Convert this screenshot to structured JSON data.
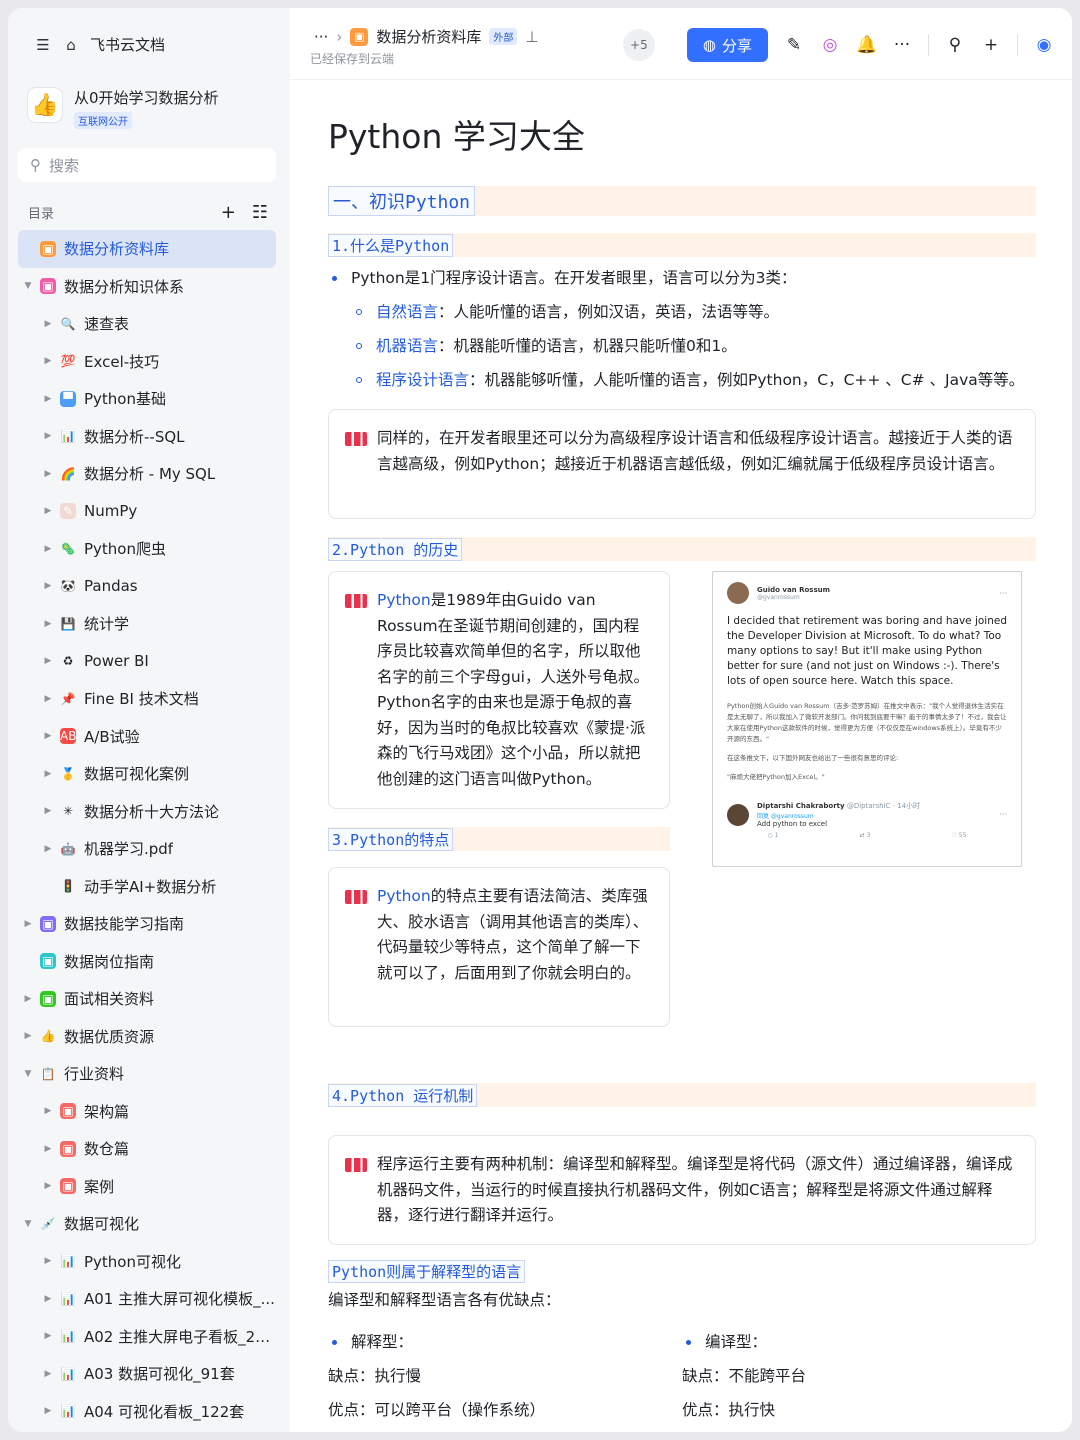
{
  "sidebar": {
    "home_label": "飞书云文档",
    "workspace_title": "从0开始学习数据分析",
    "workspace_tag": "互联网公开",
    "search_placeholder": "搜索",
    "toc_label": "目录",
    "items": [
      {
        "label": "数据分析资料库",
        "level": 0,
        "arrow": "",
        "icon": "▣",
        "color": "#ff9b3d",
        "selected": true
      },
      {
        "label": "数据分析知识体系",
        "level": 0,
        "arrow": "▼",
        "icon": "▣",
        "color": "#f05ca6"
      },
      {
        "label": "速查表",
        "level": 1,
        "arrow": "▶",
        "icon": "🔍",
        "color": "transparent"
      },
      {
        "label": "Excel-技巧",
        "level": 1,
        "arrow": "▶",
        "icon": "💯",
        "color": "transparent"
      },
      {
        "label": "Python基础",
        "level": 1,
        "arrow": "▶",
        "icon": "▀",
        "color": "#4b9ef7"
      },
      {
        "label": "数据分析--SQL",
        "level": 1,
        "arrow": "▶",
        "icon": "📊",
        "color": "transparent"
      },
      {
        "label": "数据分析 - My SQL",
        "level": 1,
        "arrow": "▶",
        "icon": "🌈",
        "color": "transparent"
      },
      {
        "label": "NumPy",
        "level": 1,
        "arrow": "▶",
        "icon": "✎",
        "color": "#f3d9d4"
      },
      {
        "label": "Python爬虫",
        "level": 1,
        "arrow": "▶",
        "icon": "🦠",
        "color": "transparent"
      },
      {
        "label": "Pandas",
        "level": 1,
        "arrow": "▶",
        "icon": "🐼",
        "color": "transparent"
      },
      {
        "label": "统计学",
        "level": 1,
        "arrow": "▶",
        "icon": "💾",
        "color": "transparent"
      },
      {
        "label": "Power BI",
        "level": 1,
        "arrow": "▶",
        "icon": "♻",
        "color": "transparent"
      },
      {
        "label": "Fine BI 技术文档",
        "level": 1,
        "arrow": "▶",
        "icon": "📌",
        "color": "transparent"
      },
      {
        "label": "A/B试验",
        "level": 1,
        "arrow": "▶",
        "icon": "AB",
        "color": "#f54a45"
      },
      {
        "label": "数据可视化案例",
        "level": 1,
        "arrow": "▶",
        "icon": "🥇",
        "color": "transparent"
      },
      {
        "label": "数据分析十大方法论",
        "level": 1,
        "arrow": "▶",
        "icon": "✳",
        "color": "transparent"
      },
      {
        "label": "机器学习.pdf",
        "level": 1,
        "arrow": "▶",
        "icon": "🤖",
        "color": "transparent"
      },
      {
        "label": "动手学AI+数据分析",
        "level": 1,
        "arrow": "",
        "icon": "🚦",
        "color": "transparent"
      },
      {
        "label": "数据技能学习指南",
        "level": 0,
        "arrow": "▶",
        "icon": "▣",
        "color": "#7f6cf7"
      },
      {
        "label": "数据岗位指南",
        "level": 0,
        "arrow": "",
        "icon": "▣",
        "color": "#2ec7c9"
      },
      {
        "label": "面试相关资料",
        "level": 0,
        "arrow": "▶",
        "icon": "▣",
        "color": "#34c724"
      },
      {
        "label": "数据优质资源",
        "level": 0,
        "arrow": "▶",
        "icon": "👍",
        "color": "transparent"
      },
      {
        "label": "行业资料",
        "level": 0,
        "arrow": "▼",
        "icon": "📋",
        "color": "transparent"
      },
      {
        "label": "架构篇",
        "level": 1,
        "arrow": "▶",
        "icon": "▣",
        "color": "#f76964"
      },
      {
        "label": "数仓篇",
        "level": 1,
        "arrow": "▶",
        "icon": "▣",
        "color": "#f76964"
      },
      {
        "label": "案例",
        "level": 1,
        "arrow": "▶",
        "icon": "▣",
        "color": "#f76964"
      },
      {
        "label": "数据可视化",
        "level": 0,
        "arrow": "▼",
        "icon": "💉",
        "color": "transparent"
      },
      {
        "label": "Python可视化",
        "level": 1,
        "arrow": "▶",
        "icon": "📊",
        "color": "transparent"
      },
      {
        "label": "A01 主推大屏可视化模板_...",
        "level": 1,
        "arrow": "▶",
        "icon": "📊",
        "color": "transparent"
      },
      {
        "label": "A02 主推大屏电子看板_20套",
        "level": 1,
        "arrow": "▶",
        "icon": "📊",
        "color": "transparent"
      },
      {
        "label": "A03 数据可视化_91套",
        "level": 1,
        "arrow": "▶",
        "icon": "📊",
        "color": "transparent"
      },
      {
        "label": "A04 可视化看板_122套",
        "level": 1,
        "arrow": "▶",
        "icon": "📊",
        "color": "transparent"
      }
    ]
  },
  "topbar": {
    "more": "···",
    "doc_name": "数据分析资料库",
    "doc_tag": "外部",
    "saved": "已经保存到云端",
    "collaborators": "+5",
    "share_label": "分享"
  },
  "doc": {
    "title": "Python 学习大全",
    "section1": "一、初识Python",
    "s1_h3": "1.什么是Python",
    "s1_bullet": "Python是1门程序设计语言。在开发者眼里，语言可以分为3类：",
    "s1_subs": [
      {
        "term": "自然语言",
        "text": "：人能听懂的语言，例如汉语，英语，法语等等。"
      },
      {
        "term": "机器语言",
        "text": "：机器能听懂的语言，机器只能听懂0和1。"
      },
      {
        "term": "程序设计语言",
        "text": "：机器能够听懂，人能听懂的语言，例如Python，C，C++ 、C# 、Java等等。"
      }
    ],
    "s1_callout": "同样的，在开发者眼里还可以分为高级程序设计语言和低级程序设计语言。越接近于人类的语言越高级，例如Python；越接近于机器语言越低级，例如汇编就属于低级程序员设计语言。",
    "s2_h3": "2.Python 的历史",
    "s2_term": "Python",
    "s2_callout": "是1989年由Guido van Rossum在圣诞节期间创建的，国内程序员比较喜欢简单但的名字，所以取他名字的前三个字母gui，人送外号龟叔。Python名字的由来也是源于龟叔的喜好，因为当时的龟叔比较喜欢《蒙提·派森的飞行马戏团》这个小品，所以就把他创建的这门语言叫做Python。",
    "s3_h3": "3.Python的特点",
    "s3_term": "Python",
    "s3_callout": "的特点主要有语法简洁、类库强大、胶水语言（调用其他语言的类库）、代码量较少等特点，这个简单了解一下就可以了，后面用到了你就会明白的。",
    "s4_h3": "4.Python 运行机制",
    "s4_callout": "程序运行主要有两种机制：编译型和解释型。编译型是将代码（源文件）通过编译器，编译成机器码文件，当运行的时候直接执行机器码文件，例如C语言；解释型是将源文件通过解释器，逐行进行翻译并运行。",
    "s5_h3": "Python则属于解释型的语言",
    "s5_intro": "编译型和解释型语言各有优缺点：",
    "left_col": {
      "title": "解释型：",
      "cons": "缺点：执行慢",
      "pros": "优点：可以跨平台（操作系统）"
    },
    "right_col": {
      "title": "编译型：",
      "cons": "缺点：不能跨平台",
      "pros": "优点：执行快"
    },
    "tweet": {
      "name": "Guido van Rossum",
      "handle": "@gvanrossum",
      "text": "I decided that retirement was boring and have joined the Developer Division at Microsoft. To do what? Too many options to say! But it'll make using Python better for sure (and not just on Windows :-). There's lots of open source here. Watch this space.",
      "cn1": "Python创始人Guido van Rossum（吉多·范罗苏姆）在推文中表示：\"我个人觉得退休生活实在是太无聊了，所以我加入了微软开发部门。你问我到底要干嘛？能干的事情太多了！不过，我会让大家在使用Python这款软件的时候，觉得更为方便（不仅仅是在windows系统上）。毕竟有不少开源的东西。\"",
      "cn2": "在这条推文下，以下国外网友也给出了一些很有意思的评论:",
      "cn3": "\"麻烦大佬把Python加入Excel。\"",
      "reply_name": "Diptarshi Chakraborty",
      "reply_handle": "@DiptarshiC · 14小时",
      "reply_to": "回复 @gvanrossum",
      "reply_text": "Add python to excel",
      "stats": [
        "1",
        "3",
        "55"
      ]
    }
  }
}
